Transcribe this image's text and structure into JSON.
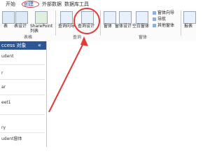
{
  "menu": {
    "tabs": [
      "开始",
      "创建",
      "外部数据",
      "数据库工具"
    ]
  },
  "ribbon": {
    "buttons": [
      "表",
      "表设计",
      "SharePoint\n列表",
      "查询向导",
      "查询设计",
      "窗体",
      "窗体设计",
      "空白窗体",
      "报表"
    ],
    "small_items": [
      "窗体向导",
      "导航",
      "其他窗体"
    ],
    "groups": [
      "表格",
      "查询",
      "窗体"
    ]
  },
  "nav": {
    "header": "ccess 对象",
    "items": [
      "udent",
      "r",
      "ar",
      "eet1",
      "ry",
      "udent窗体"
    ]
  },
  "colors": {
    "accent": "#2b5797",
    "highlight": "#e53935"
  }
}
